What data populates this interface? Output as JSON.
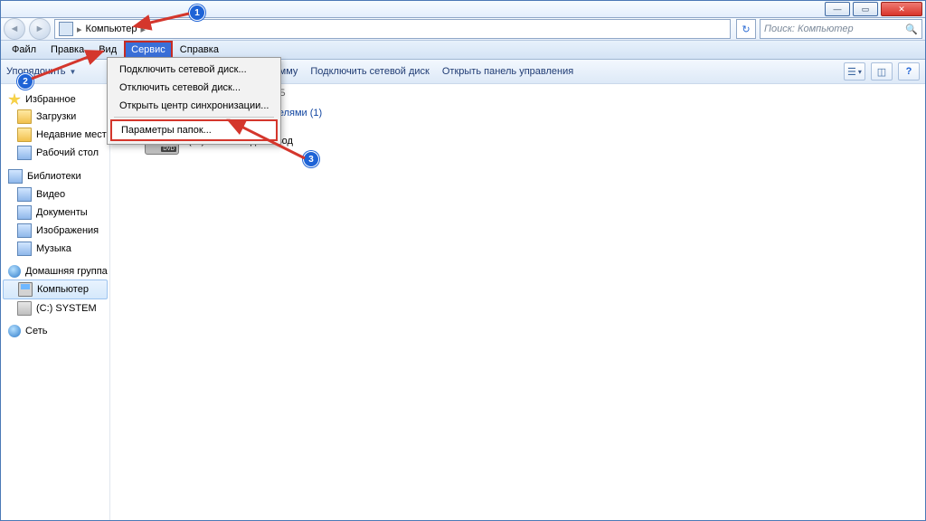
{
  "window": {
    "min": "—",
    "max": "▭",
    "close": "✕"
  },
  "address": {
    "root": "Компьютер",
    "sep": "▸",
    "refresh": "↻",
    "search_placeholder": "Поиск: Компьютер",
    "search_icon": "🔍"
  },
  "menus": {
    "file": "Файл",
    "edit": "Правка",
    "view": "Вид",
    "tools": "Сервис",
    "help": "Справка"
  },
  "dropdown": {
    "map": "Подключить сетевой диск...",
    "unmap": "Отключить сетевой диск...",
    "sync": "Открыть центр синхронизации...",
    "folder_opts": "Параметры папок..."
  },
  "toolbar": {
    "organize": "Упорядочить",
    "remove_prog_tail": "грамму",
    "map_drive": "Подключить сетевой диск",
    "open_cp": "Открыть панель управления"
  },
  "sidebar": {
    "favorites": "Избранное",
    "downloads": "Загрузки",
    "recent": "Недавние места",
    "desktop": "Рабочий стол",
    "libraries": "Библиотеки",
    "video": "Видео",
    "documents": "Документы",
    "pictures": "Изображения",
    "music": "Музыка",
    "homegroup": "Домашняя группа",
    "computer": "Компьютер",
    "c_drive": "(C:) SYSTEM",
    "network": "Сеть"
  },
  "main": {
    "drive_stats_tail": "53,0 ГБ свободно из 95,6 ГБ",
    "removable_header": "Устройства со съемными носителями (1)",
    "dvd": "(D:) DVD RW дисковод"
  },
  "callouts": {
    "n1": "1",
    "n2": "2",
    "n3": "3"
  }
}
